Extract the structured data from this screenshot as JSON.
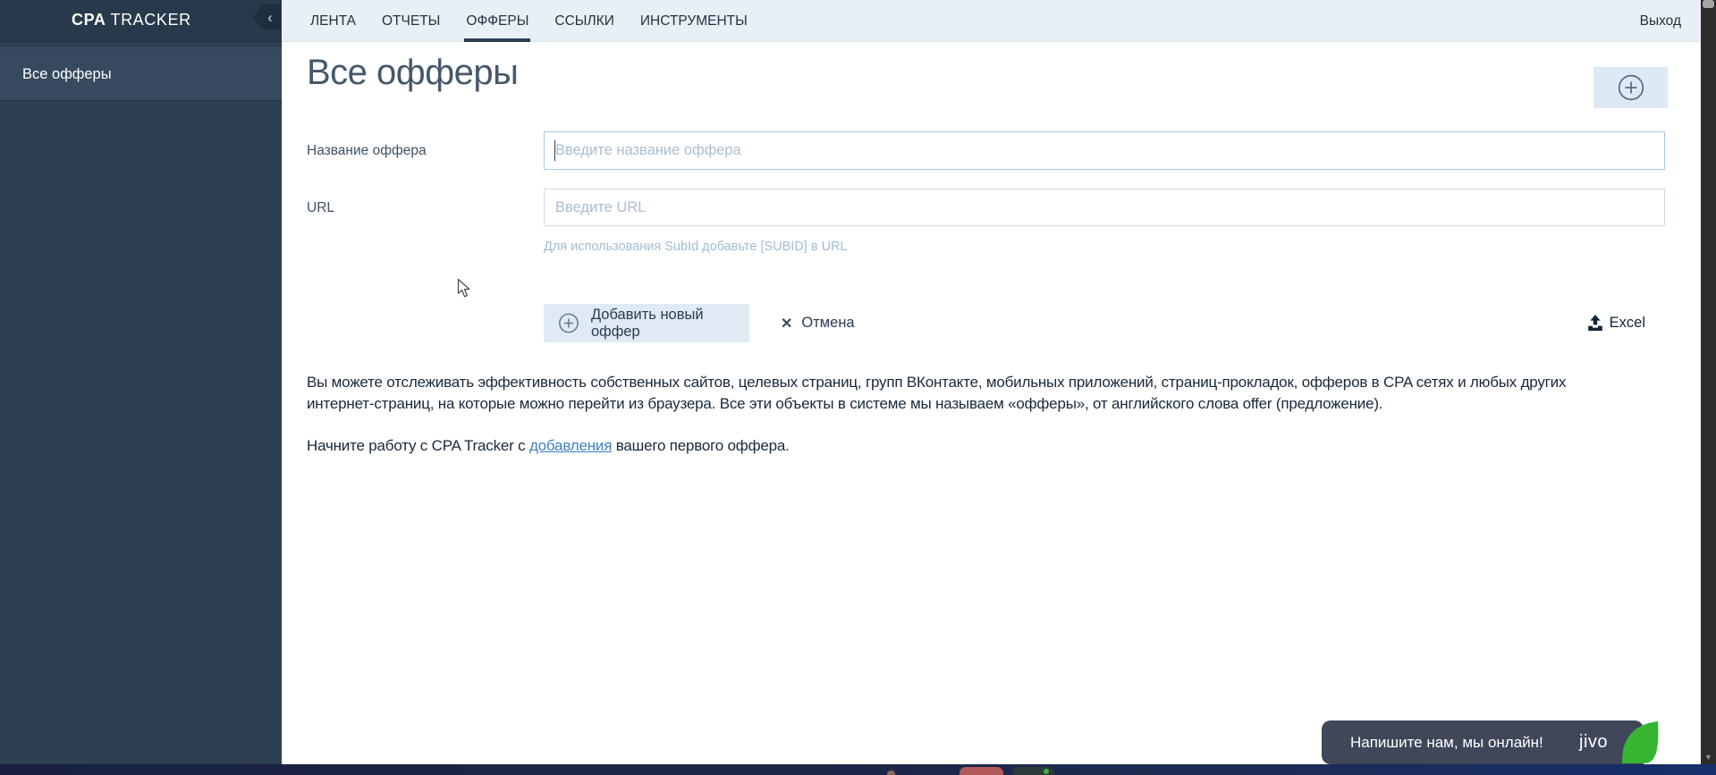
{
  "sidebar": {
    "logo_bold": "CPA",
    "logo_rest": "TRACKER",
    "items": [
      {
        "label": "Все офферы",
        "active": true
      }
    ]
  },
  "nav": {
    "tabs": [
      {
        "label": "ЛЕНТА",
        "active": false
      },
      {
        "label": "ОТЧЕТЫ",
        "active": false
      },
      {
        "label": "ОФФЕРЫ",
        "active": true
      },
      {
        "label": "ССЫЛКИ",
        "active": false
      },
      {
        "label": "ИНСТРУМЕНТЫ",
        "active": false
      }
    ],
    "logout_label": "Выход"
  },
  "main": {
    "title": "Все офферы",
    "form": {
      "name_label": "Название оффера",
      "name_placeholder": "Введите название оффера",
      "name_value": "",
      "url_label": "URL",
      "url_placeholder": "Введите URL",
      "url_value": "",
      "url_hint": "Для использования SubId добавьте [SUBID] в URL",
      "submit_label": "Добавить новый оффер",
      "cancel_label": "Отмена",
      "excel_label": "Excel"
    },
    "intro_paragraph": "Вы можете отслеживать эффективность собственных сайтов, целевых страниц, групп ВКонтакте, мобильных приложений, страниц-прокладок, офферов в CPA сетях и любых других интернет-страниц, на которые можно перейти из браузера. Все эти объекты в системе мы называем «офферы», от английского слова offer (предложение).",
    "start_text_before": "Начните работу с CPA Tracker с ",
    "start_link": "добавления",
    "start_text_after": " вашего первого оффера."
  },
  "chat_widget": {
    "message": "Напишите нам, мы онлайн!",
    "brand": "jivo"
  },
  "icons": {
    "collapse_chevron": "‹",
    "cancel_x": "✕",
    "scroll_down_arrow": "▼"
  },
  "colors": {
    "sidebar_bg": "#2c3e50",
    "sidebar_active_bg": "#36495d",
    "nav_bg": "#e9eff6",
    "active_tab_underline": "#2c3e50",
    "accent_button_bg": "#dfeaf4",
    "focused_input_border": "#a9c9e5",
    "link": "#3f80c1",
    "hint_text": "#a3bdd2",
    "jivo_bg": "#3f4759",
    "jivo_green": "#36b432",
    "bottom_bar_bg": "#1b2243"
  }
}
